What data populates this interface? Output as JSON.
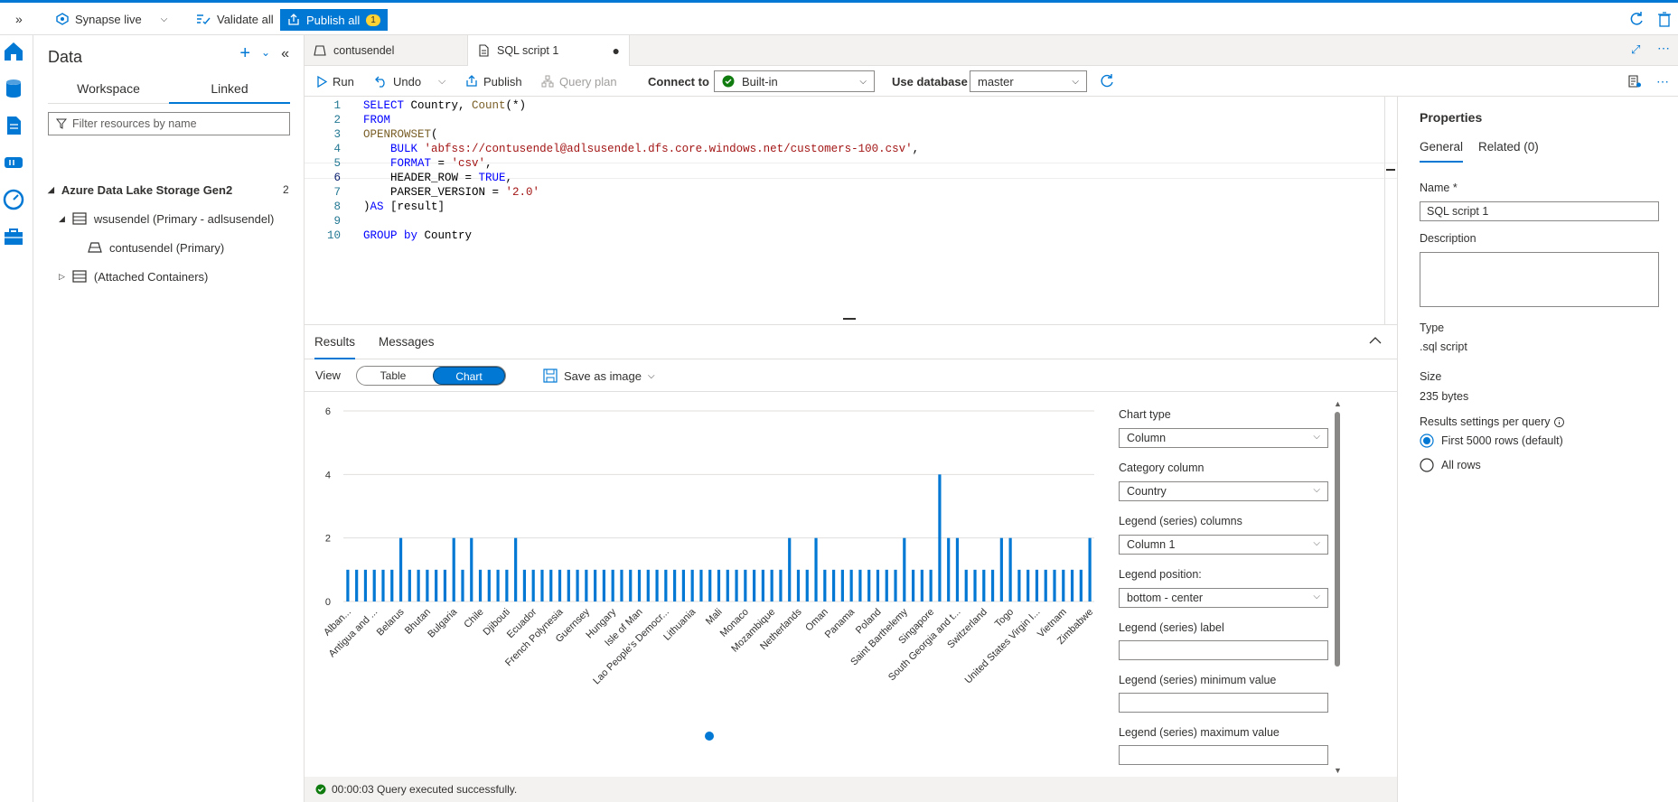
{
  "topbar": {
    "mode_label": "Synapse live",
    "validate_label": "Validate all",
    "publish_all_label": "Publish all",
    "publish_count": "1"
  },
  "data_panel": {
    "title": "Data",
    "tabs": [
      "Workspace",
      "Linked"
    ],
    "active_tab": "Linked",
    "filter_placeholder": "Filter resources by name",
    "section_title": "Azure Data Lake Storage Gen2",
    "section_count": "2",
    "items": [
      {
        "label": "wsusendel (Primary - adlsusendel)"
      },
      {
        "label": "contusendel (Primary)"
      },
      {
        "label": "(Attached Containers)"
      }
    ]
  },
  "doc_tabs": [
    {
      "label": "contusendel"
    },
    {
      "label": "SQL script 1"
    }
  ],
  "toolbar": {
    "run": "Run",
    "undo": "Undo",
    "publish": "Publish",
    "query_plan": "Query plan",
    "connect_to_label": "Connect to",
    "connect_to_value": "Built-in",
    "use_database_label": "Use database",
    "use_database_value": "master"
  },
  "editor": {
    "line_numbers": [
      "1",
      "2",
      "3",
      "4",
      "5",
      "6",
      "7",
      "8",
      "9",
      "10"
    ],
    "lines": [
      "SELECT Country, Count(*)",
      "FROM",
      "OPENROWSET(",
      "    BULK 'abfss://contusendel@adlsusendel.dfs.core.windows.net/customers-100.csv',",
      "    FORMAT = 'csv',",
      "    HEADER_ROW = TRUE,",
      "    PARSER_VERSION = '2.0'",
      ")AS [result]",
      "",
      "GROUP by Country"
    ]
  },
  "results": {
    "tabs": [
      "Results",
      "Messages"
    ],
    "active_tab": "Results",
    "view_label": "View",
    "view_options": [
      "Table",
      "Chart"
    ],
    "active_view": "Chart",
    "save_as_image": "Save as image",
    "status": "00:00:03 Query executed successfully."
  },
  "chart_settings": {
    "chart_type_label": "Chart type",
    "chart_type_value": "Column",
    "category_column_label": "Category column",
    "category_column_value": "Country",
    "legend_columns_label": "Legend (series) columns",
    "legend_columns_value": "Column 1",
    "legend_position_label": "Legend position:",
    "legend_position_value": "bottom - center",
    "legend_label_label": "Legend (series) label",
    "legend_min_label": "Legend (series) minimum value",
    "legend_max_label": "Legend (series) maximum value"
  },
  "chart_data": {
    "type": "bar",
    "ylim": [
      0,
      6
    ],
    "yticks": [
      0,
      2,
      4,
      6
    ],
    "grid": true,
    "visible_xtick_labels": [
      "Alban...",
      "Antigua and ...",
      "Belarus",
      "Bhutan",
      "Bulgaria",
      "Chile",
      "Djibouti",
      "Ecuador",
      "French Polynesia",
      "Guernsey",
      "Hungary",
      "Isle of Man",
      "Lao People's Democr...",
      "Lithuania",
      "Mali",
      "Monaco",
      "Mozambique",
      "Netherlands",
      "Oman",
      "Panama",
      "Poland",
      "Saint Barthelemy",
      "Singapore",
      "South Georgia and t...",
      "Switzerland",
      "Togo",
      "United States Virgin I...",
      "Vietnam",
      "Zimbabwe"
    ],
    "values": [
      1,
      1,
      1,
      1,
      1,
      1,
      2,
      1,
      1,
      1,
      1,
      1,
      2,
      1,
      2,
      1,
      1,
      1,
      1,
      2,
      1,
      1,
      1,
      1,
      1,
      1,
      1,
      1,
      1,
      1,
      1,
      1,
      1,
      1,
      1,
      1,
      1,
      1,
      1,
      1,
      1,
      1,
      1,
      1,
      1,
      1,
      1,
      1,
      1,
      1,
      2,
      1,
      1,
      2,
      1,
      1,
      1,
      1,
      1,
      1,
      1,
      1,
      1,
      2,
      1,
      1,
      1,
      4,
      2,
      2,
      1,
      1,
      1,
      1,
      2,
      2,
      1,
      1,
      1,
      1,
      1,
      1,
      1,
      1,
      2
    ]
  },
  "properties": {
    "title": "Properties",
    "tabs": [
      "General",
      "Related (0)"
    ],
    "name_label": "Name *",
    "name_value": "SQL script 1",
    "description_label": "Description",
    "type_label": "Type",
    "type_value": ".sql script",
    "size_label": "Size",
    "size_value": "235 bytes",
    "results_settings_label": "Results settings per query",
    "options": [
      "First 5000 rows (default)",
      "All rows"
    ]
  },
  "colors": {
    "accent": "#0078d4",
    "bar": "#0078d4",
    "success": "#107c10"
  }
}
